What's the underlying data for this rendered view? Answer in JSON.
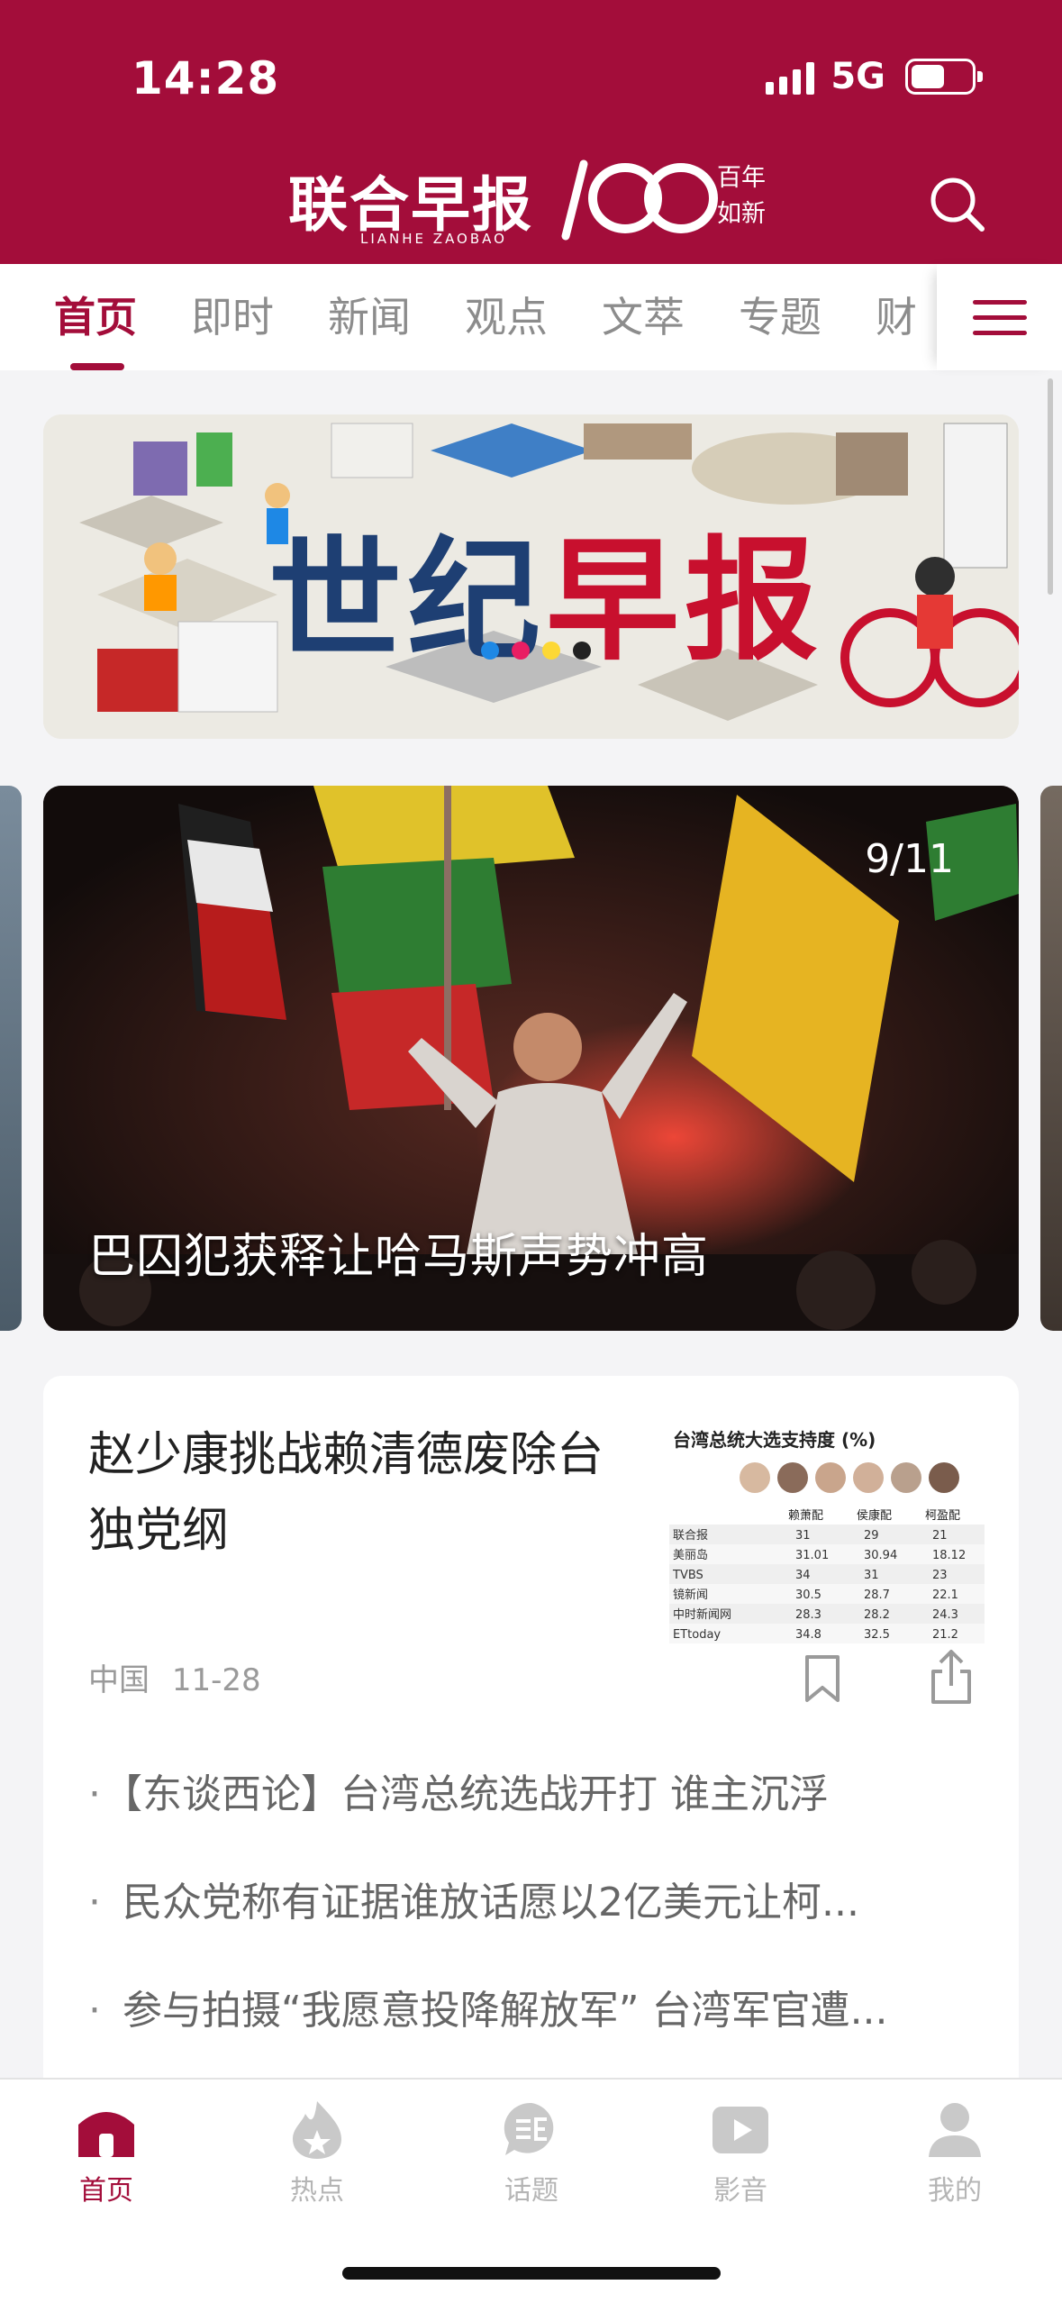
{
  "status_bar": {
    "time": "14:28",
    "network": "5G"
  },
  "header": {
    "logo_cn": "联合早报",
    "logo_en": "LIANHE ZAOBAO",
    "logo_number": "100",
    "logo_tagline": "百年如新"
  },
  "tabs": [
    {
      "label": "首页",
      "active": true
    },
    {
      "label": "即时"
    },
    {
      "label": "新闻"
    },
    {
      "label": "观点"
    },
    {
      "label": "文萃"
    },
    {
      "label": "专题"
    },
    {
      "label": "财"
    }
  ],
  "banner": {
    "title_chars": [
      "世",
      "纪",
      "早",
      "报"
    ],
    "dot_colors": [
      "#1e88e5",
      "#e91e63",
      "#fdd835",
      "#222222"
    ]
  },
  "hero": {
    "counter": "9/11",
    "caption": "巴囚犯获释让哈马斯声势冲高"
  },
  "article": {
    "title": "赵少康挑战赖清德废除台独党纲",
    "thumbnail_title": "台湾总统大选支持度 (%)",
    "thumbnail_table": {
      "headers": [
        "",
        "赖萧配",
        "侯康配",
        "柯盈配"
      ],
      "rows": [
        [
          "联合报",
          "31",
          "29",
          "21"
        ],
        [
          "美丽岛",
          "31.01",
          "30.94",
          "18.12"
        ],
        [
          "TVBS",
          "34",
          "31",
          "23"
        ],
        [
          "镜新闻",
          "30.5",
          "28.7",
          "22.1"
        ],
        [
          "中时新闻网",
          "28.3",
          "28.2",
          "24.3"
        ],
        [
          "ETtoday",
          "34.8",
          "32.5",
          "21.2"
        ]
      ]
    },
    "category": "中国",
    "date": "11-28",
    "related": [
      "【东谈西论】台湾总统选战开打 谁主沉浮",
      "民众党称有证据谁放话愿以2亿美元让柯...",
      "参与拍摄“我愿意投降解放军” 台湾军官遭..."
    ]
  },
  "bottom_nav": [
    {
      "label": "首页",
      "icon": "home-icon",
      "active": true
    },
    {
      "label": "热点",
      "icon": "flame-icon"
    },
    {
      "label": "话题",
      "icon": "topic-icon"
    },
    {
      "label": "影音",
      "icon": "video-icon"
    },
    {
      "label": "我的",
      "icon": "profile-icon"
    }
  ],
  "colors": {
    "brand": "#a30d3a",
    "inactive": "#b5b5b5"
  }
}
